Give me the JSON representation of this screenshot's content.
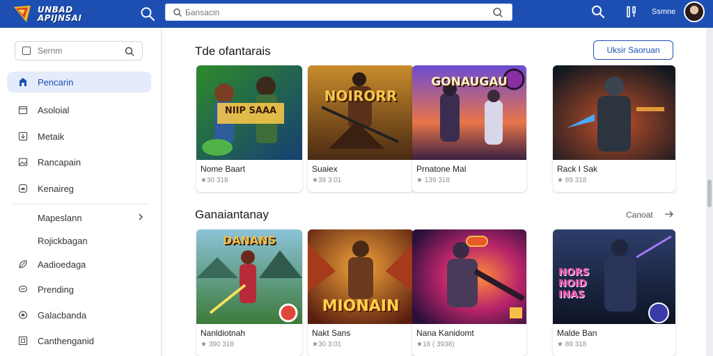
{
  "header": {
    "logo_line1": "UNBAD",
    "logo_line2": "APIJNSAI",
    "search_placeholder": "Бansacin",
    "user_label": "Ssmne"
  },
  "sidebar": {
    "search_placeholder": "Sernm",
    "items": [
      {
        "label": "Pencarin",
        "icon": "store-icon",
        "active": true
      },
      {
        "label": "Asoloial",
        "icon": "calendar-icon"
      },
      {
        "label": "Metaik",
        "icon": "download-box-icon"
      },
      {
        "label": "Rancapain",
        "icon": "image-icon"
      },
      {
        "label": "Kenaireg",
        "icon": "cloud-box-icon"
      },
      {
        "label": "Mapeslann",
        "icon": "",
        "chevron": true
      },
      {
        "label": "Rojickbagan",
        "icon": ""
      },
      {
        "label": "Aadioedaga",
        "icon": "leaf-icon"
      },
      {
        "label": "Prending",
        "icon": "chat-bubble-icon"
      },
      {
        "label": "Galacbanda",
        "icon": "disc-icon"
      },
      {
        "label": "Canthenganid",
        "icon": "frame-icon"
      }
    ]
  },
  "sections": [
    {
      "title": "Tde ofantarais",
      "action_label": "Uksir Saoruan",
      "cards": [
        {
          "title": "Nome Baart",
          "meta": "★30 318",
          "art": "green-hero",
          "banner": "NIIP SAAA"
        },
        {
          "title": "Suaiex",
          "meta": "★39 3:01",
          "art": "brown-warrior",
          "banner": "NOIRORR"
        },
        {
          "title": "Prnatone Mal",
          "meta": "★ 139 318",
          "art": "purple-sunset",
          "banner": "GONAUGAU"
        },
        {
          "title": "Rack I Sak",
          "meta": "★ 89 318",
          "art": "dark-soldier",
          "banner": ""
        }
      ]
    },
    {
      "title": "Ganaiantanay",
      "see_all_label": "Canoat",
      "cards": [
        {
          "title": "Nanldiotnah",
          "meta": "★ 390 318",
          "art": "green-field",
          "banner": "DANANS"
        },
        {
          "title": "Nakt Sans",
          "meta": "★30 3:01",
          "art": "orange-knight",
          "banner": "MIONAIN"
        },
        {
          "title": "Nana Kanidomt",
          "meta": "★18 ( 3938)",
          "art": "red-mech",
          "banner": ""
        },
        {
          "title": "Malde Ban",
          "meta": "★ 89 318",
          "art": "blue-robot",
          "banner": "NORS NOID INAS"
        }
      ]
    }
  ],
  "colors": {
    "brand": "#1d4fb3",
    "active_bg": "#e4ecfb"
  }
}
